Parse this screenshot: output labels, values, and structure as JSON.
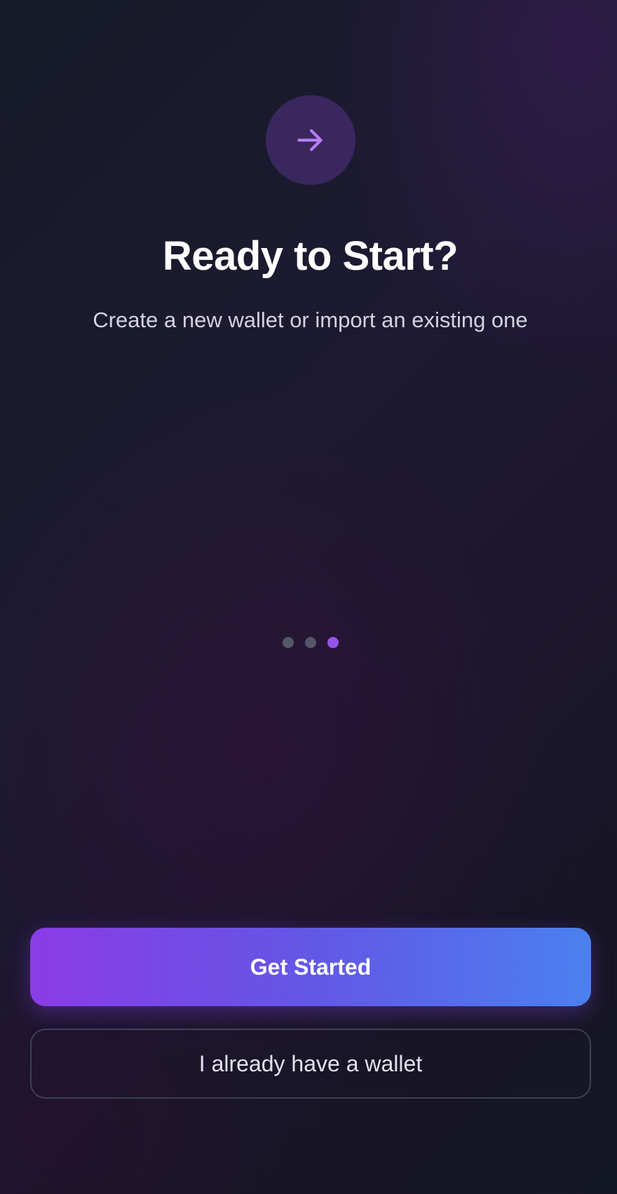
{
  "onboarding": {
    "icon": "arrow-right-icon",
    "title": "Ready to Start?",
    "subtitle": "Create a new wallet or import an existing one",
    "pagination": {
      "total": 3,
      "current": 3
    }
  },
  "actions": {
    "primary_label": "Get Started",
    "secondary_label": "I already have a wallet"
  },
  "colors": {
    "accent": "#9553ec",
    "primary_gradient_start": "#8b3be6",
    "primary_gradient_end": "#4b80ef",
    "icon_circle": "#39275e",
    "icon_stroke": "#b77cf6"
  }
}
